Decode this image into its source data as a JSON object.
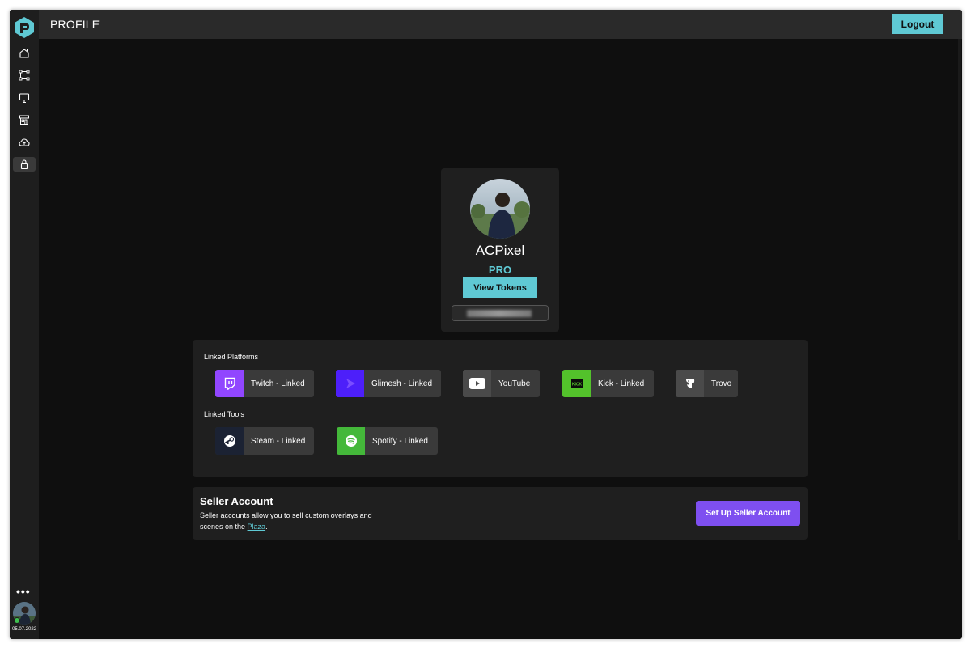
{
  "header": {
    "title": "PROFILE",
    "logout_label": "Logout"
  },
  "sidebar": {
    "items": [
      {
        "name": "home",
        "icon": "home-icon"
      },
      {
        "name": "scenes",
        "icon": "frame-icon"
      },
      {
        "name": "monitor",
        "icon": "monitor-icon"
      },
      {
        "name": "store",
        "icon": "store-icon"
      },
      {
        "name": "cloud",
        "icon": "cloud-upload-icon"
      },
      {
        "name": "lock",
        "icon": "lock-icon",
        "active": true
      }
    ],
    "more_label": "•••",
    "user_date": "05.07.2022"
  },
  "profile": {
    "username": "ACPixel",
    "tier": "PRO",
    "view_tokens_label": "View Tokens"
  },
  "linked_platforms": {
    "label": "Linked Platforms",
    "items": [
      {
        "name": "twitch",
        "label": "Twitch - Linked",
        "color": "#9146ff"
      },
      {
        "name": "glimesh",
        "label": "Glimesh - Linked",
        "color": "#4d1ffa"
      },
      {
        "name": "youtube",
        "label": "YouTube",
        "color": "#4a4a4a"
      },
      {
        "name": "kick",
        "label": "Kick - Linked",
        "color": "#53c22b"
      },
      {
        "name": "trovo",
        "label": "Trovo",
        "color": "#4a4a4a"
      }
    ]
  },
  "linked_tools": {
    "label": "Linked Tools",
    "items": [
      {
        "name": "steam",
        "label": "Steam - Linked",
        "color": "#1b2233"
      },
      {
        "name": "spotify",
        "label": "Spotify - Linked",
        "color": "#44b83a"
      }
    ]
  },
  "seller": {
    "title": "Seller Account",
    "desc_prefix": "Seller accounts allow you to sell custom overlays and scenes on the ",
    "plaza_label": "Plaza",
    "desc_suffix": ".",
    "button_label": "Set Up Seller Account"
  },
  "colors": {
    "accent": "#5fc9d4",
    "seller_button": "#7e4ff0"
  }
}
